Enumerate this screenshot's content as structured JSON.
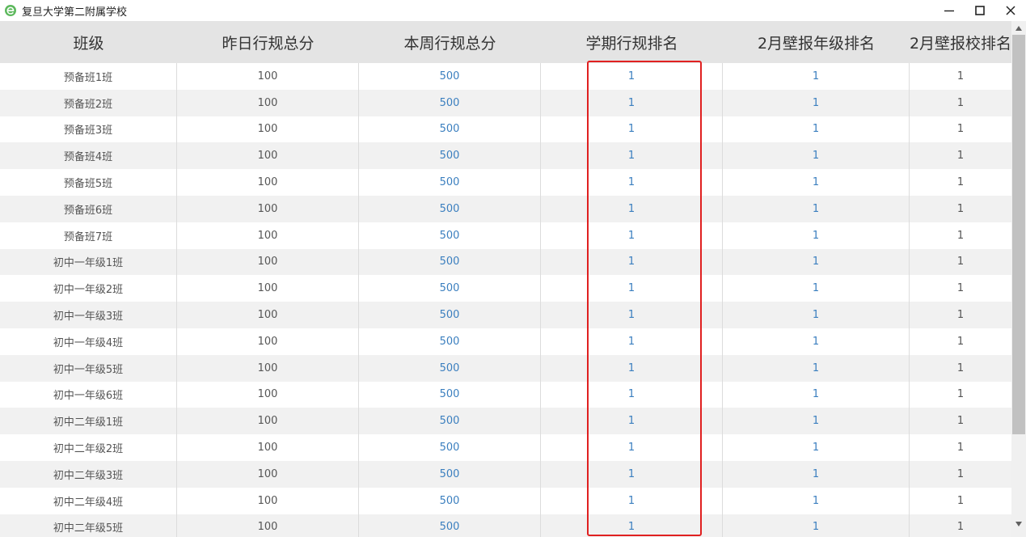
{
  "window": {
    "title": "复旦大学第二附属学校",
    "app_icon": "browser-e-icon",
    "controls": [
      "minimize-icon",
      "maximize-icon",
      "close-icon"
    ]
  },
  "table": {
    "headers": [
      "班级",
      "昨日行规总分",
      "本周行规总分",
      "学期行规排名",
      "2月壁报年级排名",
      "2月壁报校排名"
    ],
    "rows": [
      [
        "预备班1班",
        "100",
        "500",
        "1",
        "1",
        "1"
      ],
      [
        "预备班2班",
        "100",
        "500",
        "1",
        "1",
        "1"
      ],
      [
        "预备班3班",
        "100",
        "500",
        "1",
        "1",
        "1"
      ],
      [
        "预备班4班",
        "100",
        "500",
        "1",
        "1",
        "1"
      ],
      [
        "预备班5班",
        "100",
        "500",
        "1",
        "1",
        "1"
      ],
      [
        "预备班6班",
        "100",
        "500",
        "1",
        "1",
        "1"
      ],
      [
        "预备班7班",
        "100",
        "500",
        "1",
        "1",
        "1"
      ],
      [
        "初中一年级1班",
        "100",
        "500",
        "1",
        "1",
        "1"
      ],
      [
        "初中一年级2班",
        "100",
        "500",
        "1",
        "1",
        "1"
      ],
      [
        "初中一年级3班",
        "100",
        "500",
        "1",
        "1",
        "1"
      ],
      [
        "初中一年级4班",
        "100",
        "500",
        "1",
        "1",
        "1"
      ],
      [
        "初中一年级5班",
        "100",
        "500",
        "1",
        "1",
        "1"
      ],
      [
        "初中一年级6班",
        "100",
        "500",
        "1",
        "1",
        "1"
      ],
      [
        "初中二年级1班",
        "100",
        "500",
        "1",
        "1",
        "1"
      ],
      [
        "初中二年级2班",
        "100",
        "500",
        "1",
        "1",
        "1"
      ],
      [
        "初中二年级3班",
        "100",
        "500",
        "1",
        "1",
        "1"
      ],
      [
        "初中二年级4班",
        "100",
        "500",
        "1",
        "1",
        "1"
      ],
      [
        "初中二年级5班",
        "100",
        "500",
        "1",
        "1",
        "1"
      ]
    ],
    "link_columns": [
      2,
      3,
      4
    ],
    "highlighted_column": 3
  },
  "colors": {
    "header_bg": "#e4e4e4",
    "alt_row_bg": "#f1f1f1",
    "link": "#3b7fbf",
    "highlight": "#e02020",
    "app_icon": "#5cb85c"
  }
}
